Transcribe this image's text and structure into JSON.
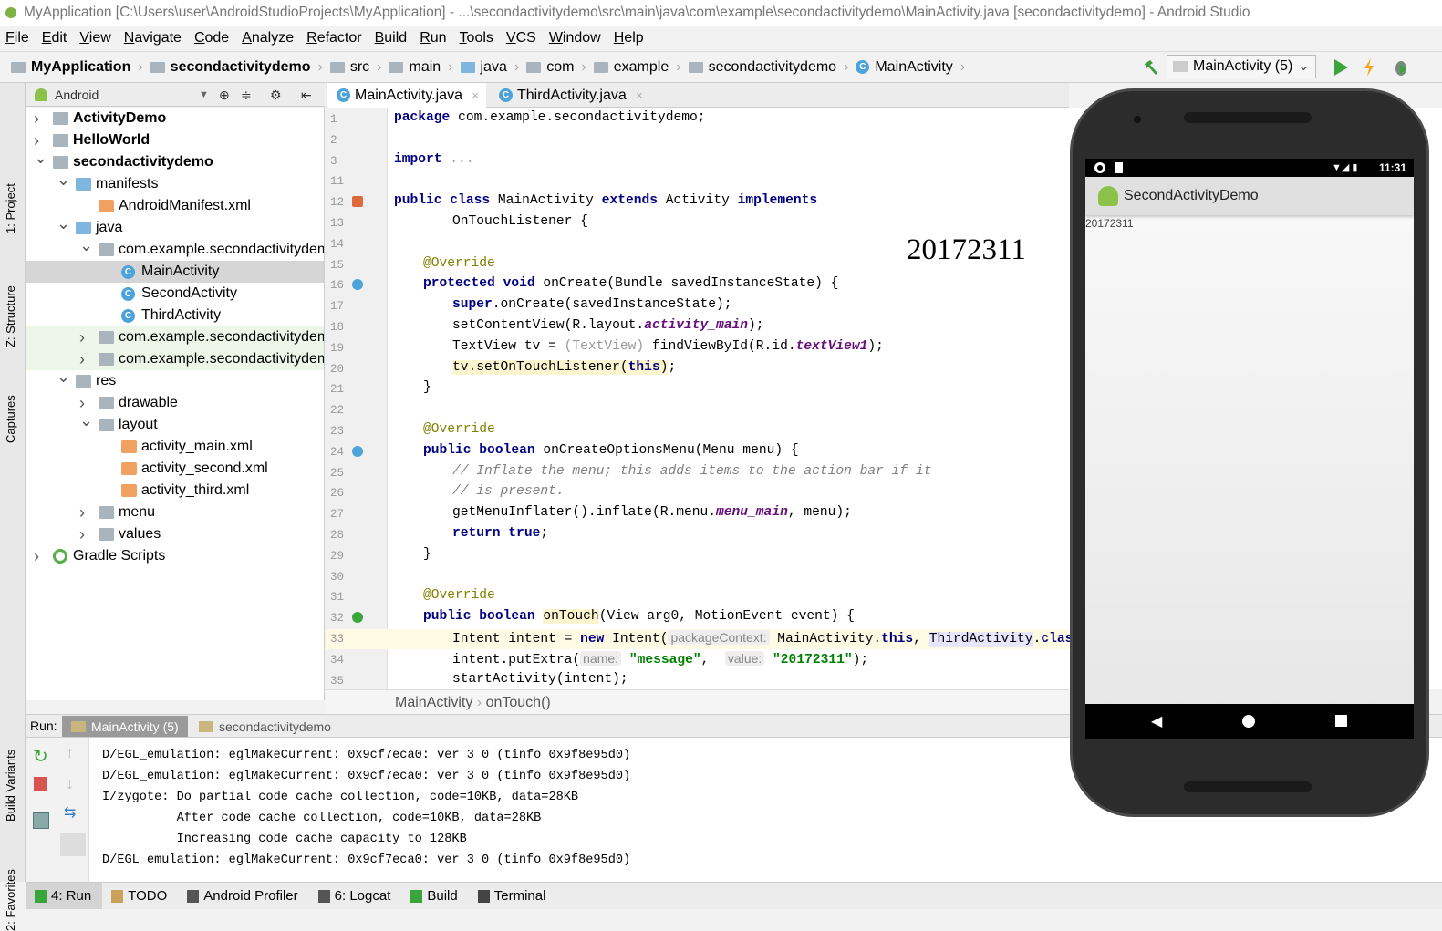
{
  "window": {
    "title": "MyApplication [C:\\Users\\user\\AndroidStudioProjects\\MyApplication] - ...\\secondactivitydemo\\src\\main\\java\\com\\example\\secondactivitydemo\\MainActivity.java [secondactivitydemo] - Android Studio"
  },
  "menu": [
    "File",
    "Edit",
    "View",
    "Navigate",
    "Code",
    "Analyze",
    "Refactor",
    "Build",
    "Run",
    "Tools",
    "VCS",
    "Window",
    "Help"
  ],
  "breadcrumbs": [
    "MyApplication",
    "secondactivitydemo",
    "src",
    "main",
    "java",
    "com",
    "example",
    "secondactivitydemo",
    "MainActivity"
  ],
  "run_config": "MainActivity (5)",
  "side_tabs": {
    "project": "1: Project",
    "structure": "Z: Structure",
    "captures": "Captures",
    "build_variants": "Build Variants",
    "favorites": "2: Favorites"
  },
  "project": {
    "view": "Android",
    "tree": [
      {
        "label": "ActivityDemo",
        "level": 0,
        "arrow": "right",
        "icon": "module",
        "bold": true
      },
      {
        "label": "HelloWorld",
        "level": 0,
        "arrow": "right",
        "icon": "module",
        "bold": true
      },
      {
        "label": "secondactivitydemo",
        "level": 0,
        "arrow": "down",
        "icon": "module",
        "bold": true
      },
      {
        "label": "manifests",
        "level": 1,
        "arrow": "down",
        "icon": "folder-blue"
      },
      {
        "label": "AndroidManifest.xml",
        "level": 2,
        "arrow": "",
        "icon": "xml"
      },
      {
        "label": "java",
        "level": 1,
        "arrow": "down",
        "icon": "folder-blue"
      },
      {
        "label": "com.example.secondactivitydemo",
        "level": 2,
        "arrow": "down",
        "icon": "package"
      },
      {
        "label": "MainActivity",
        "level": 3,
        "arrow": "",
        "icon": "class",
        "selected": true
      },
      {
        "label": "SecondActivity",
        "level": 3,
        "arrow": "",
        "icon": "class"
      },
      {
        "label": "ThirdActivity",
        "level": 3,
        "arrow": "",
        "icon": "class"
      },
      {
        "label": "com.example.secondactivitydemo",
        "level": 2,
        "arrow": "right",
        "icon": "package",
        "highlight": true
      },
      {
        "label": "com.example.secondactivitydemo",
        "level": 2,
        "arrow": "right",
        "icon": "package",
        "highlight": true
      },
      {
        "label": "res",
        "level": 1,
        "arrow": "down",
        "icon": "folder"
      },
      {
        "label": "drawable",
        "level": 2,
        "arrow": "right",
        "icon": "folder"
      },
      {
        "label": "layout",
        "level": 2,
        "arrow": "down",
        "icon": "folder"
      },
      {
        "label": "activity_main.xml",
        "level": 3,
        "arrow": "",
        "icon": "xml"
      },
      {
        "label": "activity_second.xml",
        "level": 3,
        "arrow": "",
        "icon": "xml"
      },
      {
        "label": "activity_third.xml",
        "level": 3,
        "arrow": "",
        "icon": "xml"
      },
      {
        "label": "menu",
        "level": 2,
        "arrow": "right",
        "icon": "folder"
      },
      {
        "label": "values",
        "level": 2,
        "arrow": "right",
        "icon": "folder"
      },
      {
        "label": "Gradle Scripts",
        "level": 0,
        "arrow": "right",
        "icon": "gradle"
      }
    ]
  },
  "editor": {
    "tabs": [
      {
        "label": "MainActivity.java",
        "active": true
      },
      {
        "label": "ThirdActivity.java",
        "active": false
      }
    ],
    "overlay_text": "20172311",
    "lines": [
      {
        "n": "1",
        "i": 0,
        "t": [
          [
            "package",
            "kw"
          ],
          [
            " com.example.secondactivitydemo;",
            ""
          ]
        ]
      },
      {
        "n": "2",
        "i": 0,
        "t": []
      },
      {
        "n": "3",
        "i": 0,
        "t": [
          [
            "import",
            "kw"
          ],
          [
            " ...",
            "gr"
          ]
        ]
      },
      {
        "n": "11",
        "i": 0,
        "t": []
      },
      {
        "n": "12",
        "i": 0,
        "t": [
          [
            "public class",
            "kw"
          ],
          [
            " MainActivity ",
            ""
          ],
          [
            "extends",
            "kw"
          ],
          [
            " Activity ",
            ""
          ],
          [
            "implements",
            "kw"
          ]
        ]
      },
      {
        "n": "13",
        "i": 2,
        "t": [
          [
            "OnTouchListener {",
            ""
          ]
        ]
      },
      {
        "n": "14",
        "i": 0,
        "t": []
      },
      {
        "n": "15",
        "i": 1,
        "t": [
          [
            "@Override",
            "an"
          ]
        ]
      },
      {
        "n": "16",
        "i": 1,
        "t": [
          [
            "protected void",
            "kw"
          ],
          [
            " onCreate(Bundle savedInstanceState) {",
            ""
          ]
        ]
      },
      {
        "n": "17",
        "i": 2,
        "t": [
          [
            "super",
            "kw"
          ],
          [
            ".onCreate(savedInstanceState);",
            ""
          ]
        ]
      },
      {
        "n": "18",
        "i": 2,
        "t": [
          [
            "setContentView(R.layout.",
            ""
          ],
          [
            "activity_main",
            "fd"
          ],
          [
            ");",
            ""
          ]
        ]
      },
      {
        "n": "19",
        "i": 2,
        "t": [
          [
            "TextView tv = ",
            ""
          ],
          [
            "(TextView)",
            "gr"
          ],
          [
            " findViewById(R.id.",
            ""
          ],
          [
            "textView1",
            "fd"
          ],
          [
            ");",
            ""
          ]
        ]
      },
      {
        "n": "20",
        "i": 2,
        "t": [
          [
            "tv.setOnTouchListener(",
            "yl"
          ],
          [
            "this",
            "kw yl"
          ],
          [
            ")",
            "yl"
          ],
          [
            ";",
            ""
          ]
        ]
      },
      {
        "n": "21",
        "i": 1,
        "t": [
          [
            "}",
            ""
          ]
        ]
      },
      {
        "n": "22",
        "i": 0,
        "t": []
      },
      {
        "n": "23",
        "i": 1,
        "t": [
          [
            "@Override",
            "an"
          ]
        ]
      },
      {
        "n": "24",
        "i": 1,
        "t": [
          [
            "public boolean",
            "kw"
          ],
          [
            " onCreateOptionsMenu(Menu menu) {",
            ""
          ]
        ]
      },
      {
        "n": "25",
        "i": 2,
        "t": [
          [
            "// Inflate the menu; this adds items to the action bar if it",
            "cm"
          ]
        ]
      },
      {
        "n": "26",
        "i": 2,
        "t": [
          [
            "// is present.",
            "cm"
          ]
        ]
      },
      {
        "n": "27",
        "i": 2,
        "t": [
          [
            "getMenuInflater().inflate(R.menu.",
            ""
          ],
          [
            "menu_main",
            "fd"
          ],
          [
            ", menu);",
            ""
          ]
        ]
      },
      {
        "n": "28",
        "i": 2,
        "t": [
          [
            "return true",
            "kw"
          ],
          [
            ";",
            ""
          ]
        ]
      },
      {
        "n": "29",
        "i": 1,
        "t": [
          [
            "}",
            ""
          ]
        ]
      },
      {
        "n": "30",
        "i": 0,
        "t": []
      },
      {
        "n": "31",
        "i": 1,
        "t": [
          [
            "@Override",
            "an"
          ]
        ]
      },
      {
        "n": "32",
        "i": 1,
        "t": [
          [
            "public boolean",
            "kw"
          ],
          [
            " ",
            ""
          ],
          [
            "onTouch",
            "yl"
          ],
          [
            "(View arg0, MotionEvent event) {",
            ""
          ]
        ]
      },
      {
        "n": "33",
        "i": 2,
        "t": [
          [
            "Intent intent = ",
            ""
          ],
          [
            "new",
            "kw"
          ],
          [
            " Intent(",
            ""
          ],
          [
            "packageContext:",
            "hint"
          ],
          [
            " MainActivity.",
            ""
          ],
          [
            "this",
            "kw"
          ],
          [
            ", ",
            ""
          ],
          [
            "ThirdActivity",
            "ref"
          ],
          [
            ".",
            ""
          ],
          [
            "class",
            "kw"
          ],
          [
            ");",
            ""
          ]
        ]
      },
      {
        "n": "34",
        "i": 2,
        "t": [
          [
            "intent.putExtra(",
            ""
          ],
          [
            "name:",
            "hint"
          ],
          [
            " ",
            ""
          ],
          [
            "\"message\"",
            "st"
          ],
          [
            ",  ",
            ""
          ],
          [
            "value:",
            "hint"
          ],
          [
            " ",
            ""
          ],
          [
            "\"20172311\"",
            "st"
          ],
          [
            ");",
            ""
          ]
        ]
      },
      {
        "n": "35",
        "i": 2,
        "t": [
          [
            "startActivity(intent);",
            ""
          ]
        ]
      }
    ],
    "breadcrumb": [
      "MainActivity",
      "onTouch()"
    ]
  },
  "run": {
    "label": "Run:",
    "tabs": [
      "MainActivity (5)",
      "secondactivitydemo"
    ],
    "console": [
      "D/EGL_emulation: eglMakeCurrent: 0x9cf7eca0: ver 3 0 (tinfo 0x9f8e95d0)",
      "D/EGL_emulation: eglMakeCurrent: 0x9cf7eca0: ver 3 0 (tinfo 0x9f8e95d0)",
      "I/zygote: Do partial code cache collection, code=10KB, data=28KB",
      "          After code cache collection, code=10KB, data=28KB",
      "          Increasing code cache capacity to 128KB",
      "D/EGL_emulation: eglMakeCurrent: 0x9cf7eca0: ver 3 0 (tinfo 0x9f8e95d0)"
    ]
  },
  "bottom_tabs": [
    "4: Run",
    "TODO",
    "Android Profiler",
    "6: Logcat",
    "Build",
    "Terminal"
  ],
  "phone": {
    "time": "11:31",
    "app_title": "SecondActivityDemo",
    "text": "20172311"
  },
  "colors": {
    "keyword": "#000080",
    "string": "#008000",
    "field": "#660e7a",
    "annotation": "#808000",
    "accent": "#4ba3d9"
  }
}
